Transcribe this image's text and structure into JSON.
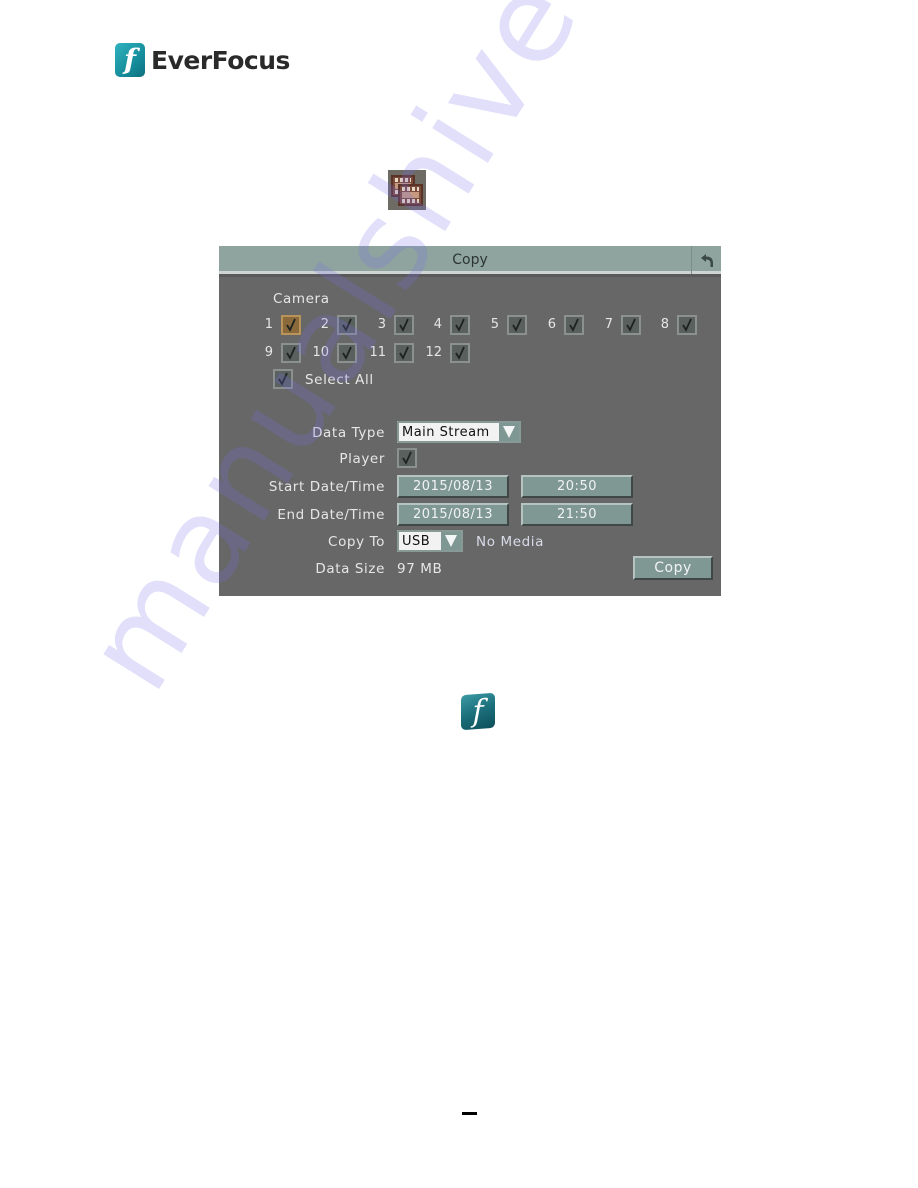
{
  "brand": {
    "name": "EverFocus",
    "mark": "f",
    "color": "#1a9aa8"
  },
  "icons": {
    "copy": "film-copy-icon",
    "back": "back-arrow-icon",
    "footer_logo": "everfocus-logo-icon"
  },
  "dialog": {
    "title": "Copy",
    "camera_section_label": "Camera",
    "cameras": [
      {
        "number": "1",
        "checked": true,
        "focused": true
      },
      {
        "number": "2",
        "checked": true
      },
      {
        "number": "3",
        "checked": true
      },
      {
        "number": "4",
        "checked": true
      },
      {
        "number": "5",
        "checked": true
      },
      {
        "number": "6",
        "checked": true
      },
      {
        "number": "7",
        "checked": true
      },
      {
        "number": "8",
        "checked": true
      },
      {
        "number": "9",
        "checked": true
      },
      {
        "number": "10",
        "checked": true
      },
      {
        "number": "11",
        "checked": true
      },
      {
        "number": "12",
        "checked": true
      }
    ],
    "select_all": {
      "label": "Select  All",
      "checked": true
    },
    "data_type": {
      "label": "Data  Type",
      "value": "Main  Stream"
    },
    "player": {
      "label": "Player",
      "checked": true
    },
    "start": {
      "label": "Start  Date/Time",
      "date": "2015/08/13",
      "time": "20:50"
    },
    "end": {
      "label": "End  Date/Time",
      "date": "2015/08/13",
      "time": "21:50"
    },
    "copy_to": {
      "label": "Copy  To",
      "value": "USB",
      "status": "No  Media"
    },
    "data_size": {
      "label": "Data  Size",
      "value": "97  MB"
    },
    "copy_button": "Copy"
  },
  "watermark": "manualshive.com"
}
